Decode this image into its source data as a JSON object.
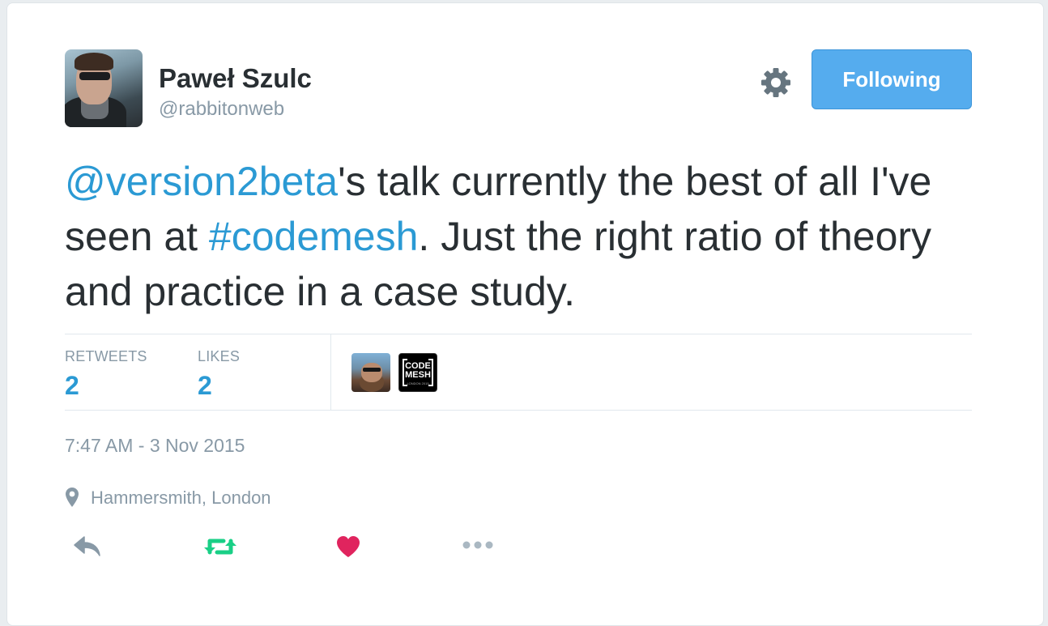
{
  "user": {
    "display_name": "Paweł Szulc",
    "screen_name": "@rabbitonweb"
  },
  "follow_button": {
    "label": "Following"
  },
  "tweet": {
    "mention": "@version2beta",
    "text_1": "'s talk currently the best of all I've seen at ",
    "hashtag": "#codemesh",
    "text_2": ". Just the right ratio of theory and practice in a case study."
  },
  "stats": {
    "retweets_label": "RETWEETS",
    "retweets_count": "2",
    "likes_label": "LIKES",
    "likes_count": "2"
  },
  "likers": {
    "codemesh_avatar_text_line1": "CODE",
    "codemesh_avatar_text_line2": "MESH",
    "codemesh_avatar_text_line3": "LONDON 2015"
  },
  "timestamp": "7:47 AM - 3 Nov 2015",
  "location": "Hammersmith, London",
  "colors": {
    "link": "#2b9ad4",
    "follow_button": "#55acee",
    "retweet_green": "#19cf86",
    "like_red": "#e0245e",
    "muted": "#8899a6"
  },
  "icons": {
    "gear": "gear-icon",
    "location": "map-pin-icon",
    "reply": "reply-icon",
    "retweet": "retweet-icon",
    "like": "heart-icon",
    "more": "more-icon"
  }
}
